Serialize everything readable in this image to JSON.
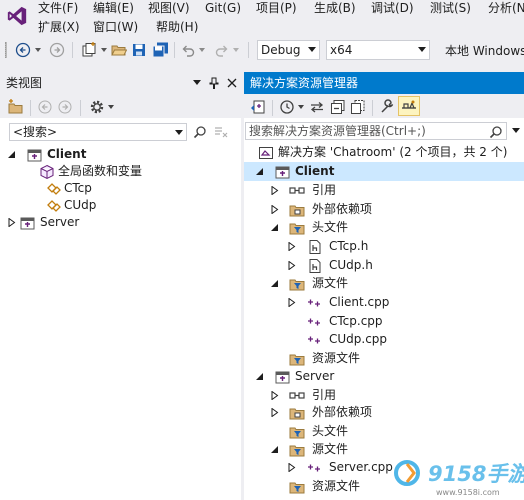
{
  "menu": {
    "row1": [
      "文件(F)",
      "编辑(E)",
      "视图(V)",
      "Git(G)",
      "项目(P)",
      "生成(B)",
      "调试(D)",
      "测试(S)",
      "分析(N"
    ],
    "row2": [
      "扩展(X)",
      "窗口(W)",
      "帮助(H)"
    ]
  },
  "toolbar": {
    "config": "Debug",
    "platform": "x64",
    "run_label": "本地 Windows"
  },
  "class_view": {
    "title": "类视图",
    "search_placeholder": "<搜索>",
    "items": [
      {
        "label": "Client",
        "bold": true
      },
      {
        "label": "全局函数和变量"
      },
      {
        "label": "CTcp"
      },
      {
        "label": "CUdp"
      },
      {
        "label": "Server"
      }
    ]
  },
  "solution_explorer": {
    "title": "解决方案资源管理器",
    "search_placeholder": "搜索解决方案资源管理器(Ctrl+;)",
    "solution_label": "解决方案 'Chatroom' (2 个项目，共 2 个)",
    "items": [
      {
        "label": "Client",
        "bold": true
      },
      {
        "label": "引用"
      },
      {
        "label": "外部依赖项"
      },
      {
        "label": "头文件"
      },
      {
        "label": "CTcp.h"
      },
      {
        "label": "CUdp.h"
      },
      {
        "label": "源文件"
      },
      {
        "label": "Client.cpp"
      },
      {
        "label": "CTcp.cpp"
      },
      {
        "label": "CUdp.cpp"
      },
      {
        "label": "资源文件"
      },
      {
        "label": "Server"
      },
      {
        "label": "引用"
      },
      {
        "label": "外部依赖项"
      },
      {
        "label": "头文件"
      },
      {
        "label": "源文件"
      },
      {
        "label": "Server.cpp"
      },
      {
        "label": "资源文件"
      }
    ]
  },
  "watermark": {
    "brand": "9158手游",
    "url": "www.9158i.com"
  },
  "colors": {
    "accent": "#007acc",
    "selection": "#cce8ff",
    "folder": "#dcb67a",
    "vs_purple": "#68217a"
  }
}
